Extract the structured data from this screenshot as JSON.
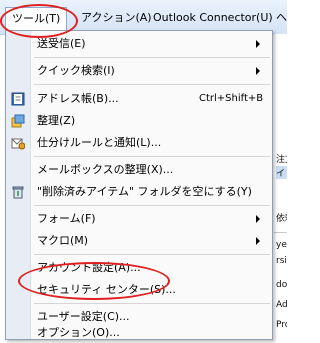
{
  "menubar": {
    "tools": "ツール(T)",
    "action": "アクション(A)",
    "outlook_connector": "Outlook Connector(U)",
    "next": "ヘ"
  },
  "menu": {
    "items": [
      {
        "label": "送受信(E)",
        "submenu": true
      },
      {
        "label": "クイック検索(I)",
        "submenu": true
      },
      {
        "label": "アドレス帳(B)...",
        "shortcut": "Ctrl+Shift+B",
        "icon": "address-book-icon"
      },
      {
        "label": "整理(Z)",
        "icon": "organize-icon"
      },
      {
        "label": "仕分けルールと通知(L)...",
        "icon": "rules-icon"
      },
      {
        "label": "メールボックスの整理(X)..."
      },
      {
        "label": "\"削除済みアイテム\" フォルダを空にする(Y)",
        "icon": "empty-trash-icon"
      },
      {
        "label": "フォーム(F)",
        "submenu": true
      },
      {
        "label": "マクロ(M)",
        "submenu": true
      },
      {
        "label": "アカウント設定(A)..."
      },
      {
        "label": "セキュリティ センター(S)..."
      },
      {
        "label": "ユーザー設定(C)..."
      },
      {
        "label": "オプション(O)..."
      }
    ]
  },
  "background": {
    "frag1": "注文",
    "frag2": "イリ",
    "frag3": "依頼",
    "frag4": "ye: M",
    "frag5": "rsion",
    "frag6": "dow",
    "frag7": "Adv",
    "frag8": "Prod"
  },
  "colors": {
    "accent_red": "#e02020",
    "menubar": "#d4e3f6",
    "gutter": "#e8edf5"
  }
}
